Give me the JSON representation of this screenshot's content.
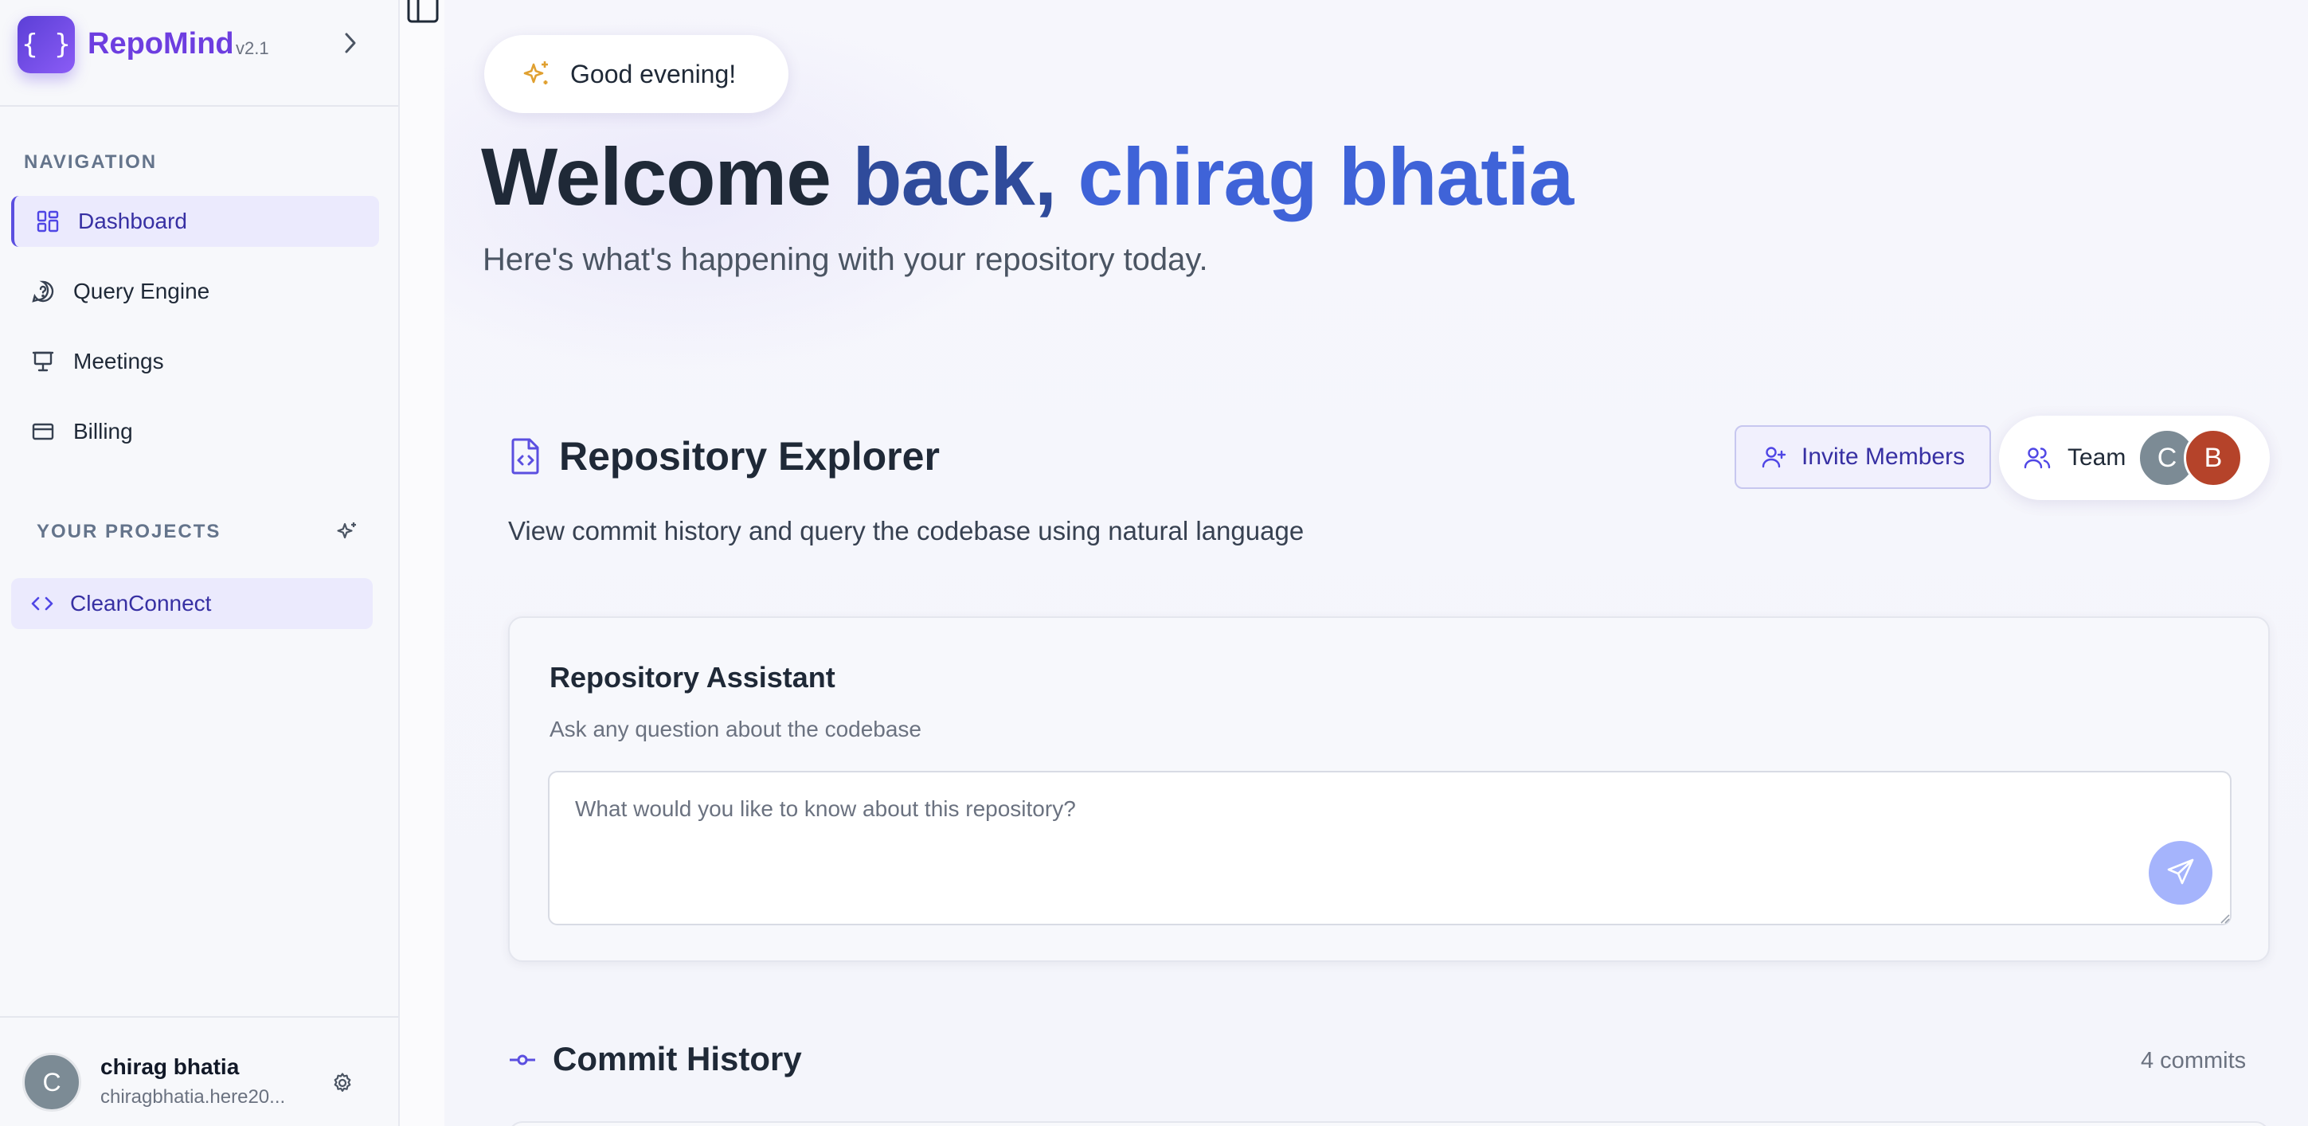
{
  "sidebar": {
    "brand": {
      "logo_glyph": "{ }",
      "name": "RepoMind",
      "version": "v2.1"
    },
    "navigation_label": "NAVIGATION",
    "nav_items": [
      {
        "label": "Dashboard",
        "icon": "dashboard-icon",
        "active": true
      },
      {
        "label": "Query Engine",
        "icon": "chat-question-icon",
        "active": false
      },
      {
        "label": "Meetings",
        "icon": "presentation-icon",
        "active": false
      },
      {
        "label": "Billing",
        "icon": "credit-card-icon",
        "active": false
      }
    ],
    "projects_label": "YOUR PROJECTS",
    "projects": [
      {
        "label": "CleanConnect",
        "icon": "code-icon",
        "active": true
      }
    ],
    "user": {
      "initial": "C",
      "name": "chirag bhatia",
      "email": "chiragbhatia.here20..."
    }
  },
  "main": {
    "greeting": "Good evening!",
    "welcome": {
      "prefix": "Welcome ",
      "middle": "back, ",
      "name": "chirag bhatia"
    },
    "subtitle": "Here's what's happening with your repository today.",
    "repo_explorer": {
      "title": "Repository Explorer",
      "description": "View commit history and query the codebase using natural language",
      "invite_label": "Invite Members",
      "team_label": "Team",
      "team_members": [
        {
          "initial": "C",
          "color": "#7c8b95"
        },
        {
          "initial": "B",
          "color": "#b5432a"
        }
      ]
    },
    "assistant": {
      "title": "Repository Assistant",
      "subtitle": "Ask any question about the codebase",
      "placeholder": "What would you like to know about this repository?",
      "value": ""
    },
    "commit_history": {
      "title": "Commit History",
      "count_label": "4 commits"
    }
  },
  "colors": {
    "brand": "#6d3ee0",
    "accent": "#3f63d8",
    "active_bg": "#ebeafd",
    "active_text": "#3730a3",
    "send_button": "#a5b4fc"
  }
}
